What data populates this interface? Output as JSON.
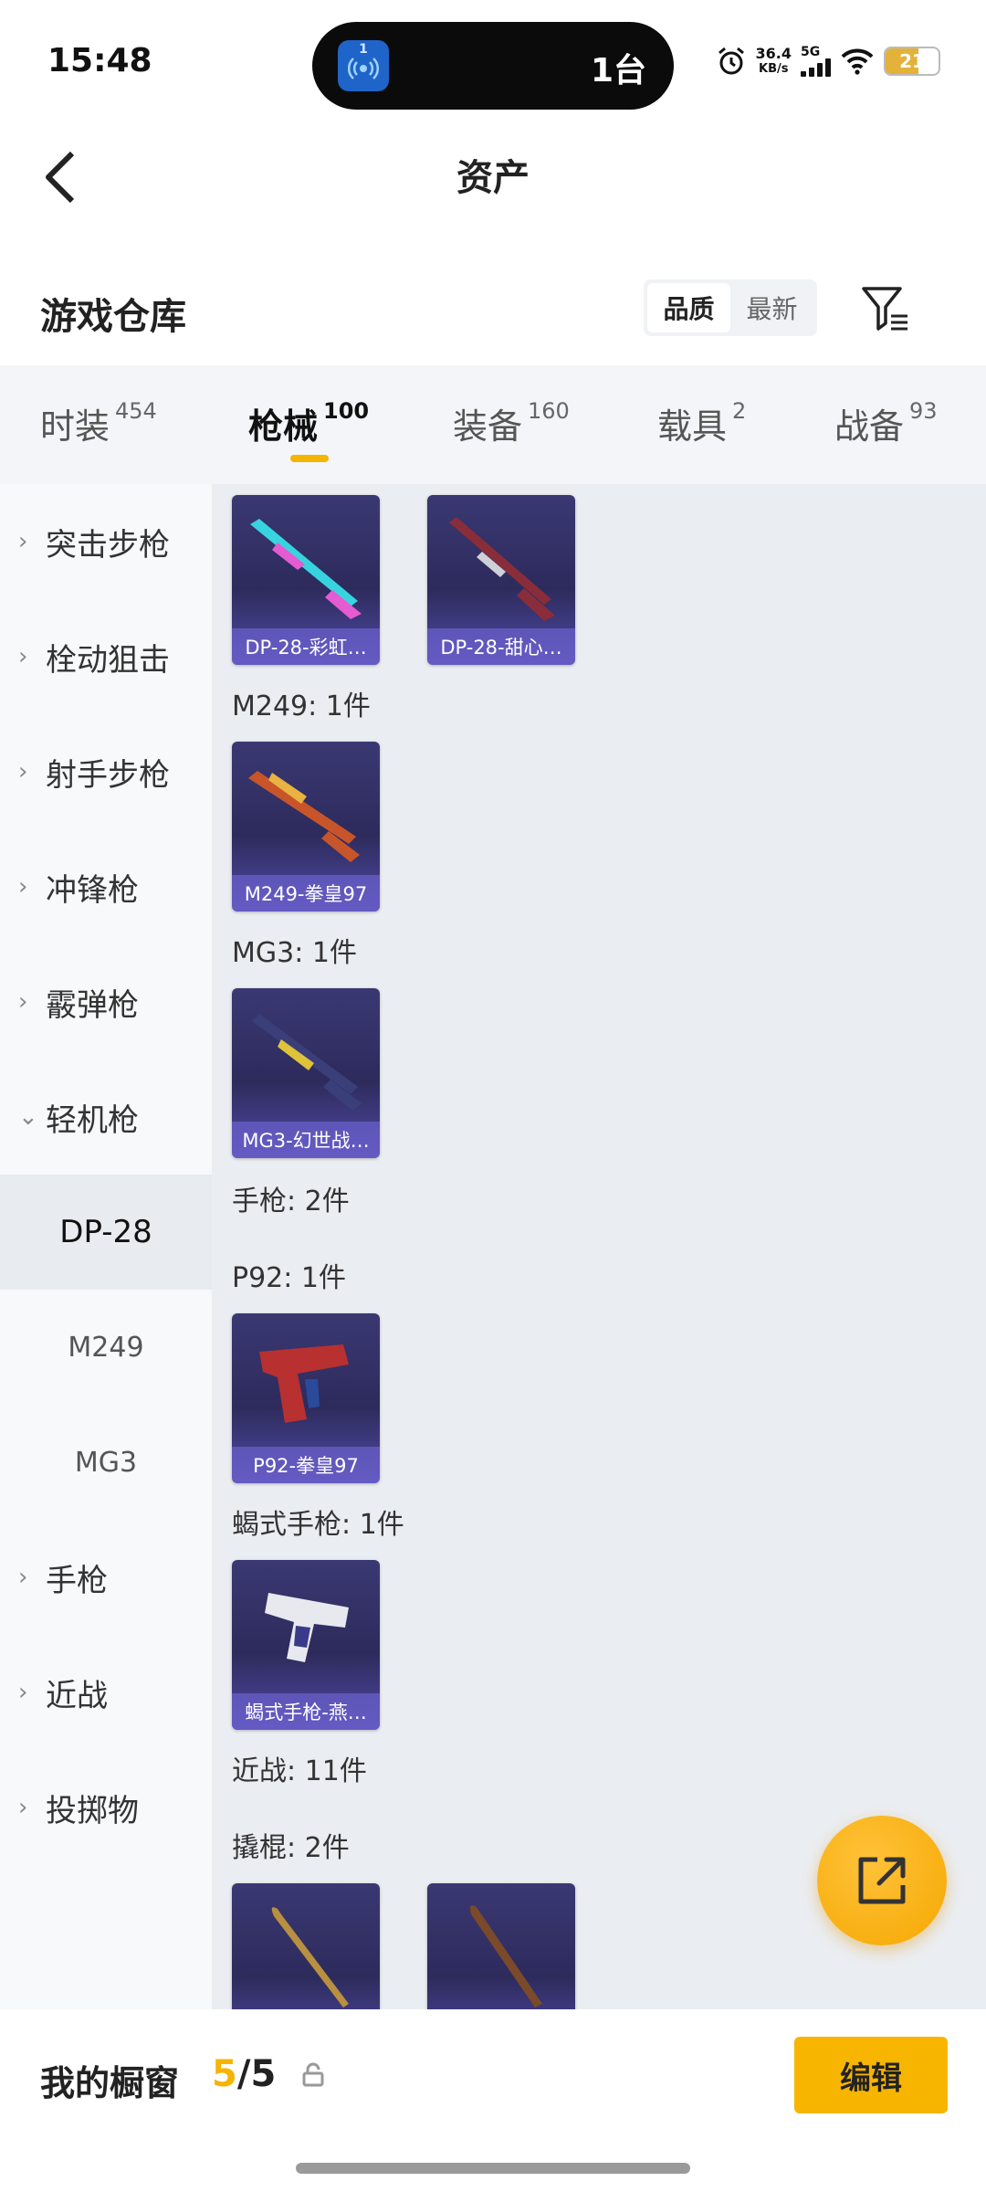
{
  "status_bar": {
    "time": "15:48",
    "island_app_badge": "1",
    "island_text": "1台",
    "net_speed_value": "36.4",
    "net_speed_unit": "KB/s",
    "network_type": "5G",
    "battery": "21",
    "icons": [
      "alarm-icon",
      "signal-icon",
      "wifi-icon",
      "battery-icon"
    ]
  },
  "header": {
    "title": "资产"
  },
  "section": {
    "title": "游戏仓库",
    "sort_options": [
      {
        "label": "品质",
        "active": true
      },
      {
        "label": "最新",
        "active": false
      }
    ]
  },
  "tabs": [
    {
      "label": "时装",
      "count": "454",
      "active": false
    },
    {
      "label": "枪械",
      "count": "100",
      "active": true
    },
    {
      "label": "装备",
      "count": "160",
      "active": false
    },
    {
      "label": "载具",
      "count": "2",
      "active": false
    },
    {
      "label": "战备",
      "count": "93",
      "active": false
    }
  ],
  "sidebar": {
    "items": [
      {
        "label": "突击步枪",
        "chevron": "›"
      },
      {
        "label": "栓动狙击",
        "chevron": "›"
      },
      {
        "label": "射手步枪",
        "chevron": "›"
      },
      {
        "label": "冲锋枪",
        "chevron": "›"
      },
      {
        "label": "霰弹枪",
        "chevron": "›"
      },
      {
        "label": "轻机枪",
        "chevron": "⌄"
      },
      {
        "label": "DP-28"
      },
      {
        "label": "M249"
      },
      {
        "label": "MG3"
      },
      {
        "label": "手枪",
        "chevron": "›"
      },
      {
        "label": "近战",
        "chevron": "›"
      },
      {
        "label": "投掷物",
        "chevron": "›"
      }
    ]
  },
  "content": {
    "cards": [
      {
        "label": "DP-28-彩虹…",
        "gun_color": "#37d4e0",
        "accent": "#e55bd1"
      },
      {
        "label": "DP-28-甜心…",
        "gun_color": "#8a2d3a",
        "accent": "#d0d0d8"
      },
      {
        "label": "M249-拳皇97",
        "gun_color": "#c8552a",
        "accent": "#e8b340"
      },
      {
        "label": "MG3-幻世战…",
        "gun_color": "#3a3f7a",
        "accent": "#e0c23a"
      },
      {
        "label": "P92-拳皇97",
        "gun_color": "#b83030",
        "accent": "#2a4a9a"
      },
      {
        "label": "蝎式手枪-燕…",
        "gun_color": "#e8e8ef",
        "accent": "#3a3a8a"
      },
      {
        "label": "",
        "gun_color": "#b89040",
        "accent": "#8a6a28"
      },
      {
        "label": "",
        "gun_color": "#7a4a2a",
        "accent": "#5a3218"
      }
    ],
    "groups": [
      "M249: 1件",
      "MG3: 1件",
      "手枪: 2件",
      "P92: 1件",
      "蝎式手枪: 1件",
      "近战: 11件",
      "撬棍: 2件"
    ]
  },
  "bottom_bar": {
    "title": "我的橱窗",
    "count_used": "5",
    "count_sep": "/",
    "count_total": "5",
    "edit_label": "编辑"
  },
  "colors": {
    "accent": "#f5b400",
    "card_bg": "#2d2b5c"
  }
}
